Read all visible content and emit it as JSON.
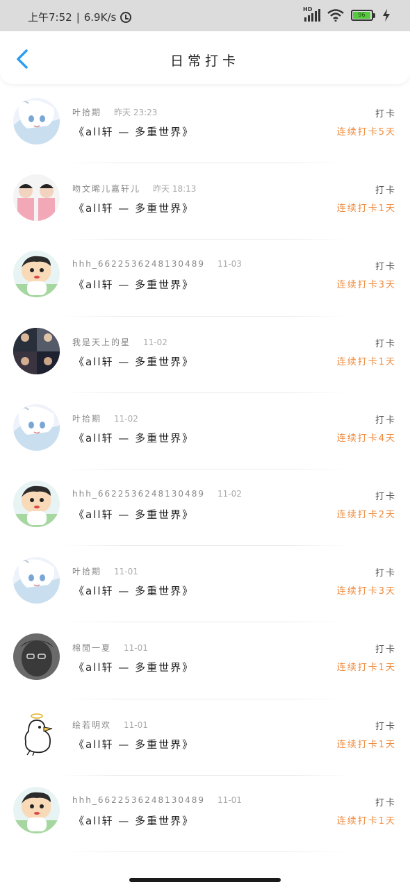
{
  "status_bar": {
    "time": "上午7:52",
    "speed": "6.9K/s",
    "network": "HD",
    "battery": "96"
  },
  "header": {
    "title": "日常打卡"
  },
  "items": [
    {
      "username": "叶拾期",
      "time": "昨天 23:23",
      "content": "《all轩 — 多重世界》",
      "tag": "打卡",
      "streak": "连续打卡5天",
      "avatar": "anime-avatar"
    },
    {
      "username": "吻文晞儿嘉轩儿",
      "time": "昨天 18:13",
      "content": "《all轩 — 多重世界》",
      "tag": "打卡",
      "streak": "连续打卡1天",
      "avatar": "photo-avatar"
    },
    {
      "username": "hhh_6622536248130489",
      "time": "11-03",
      "content": "《all轩 — 多重世界》",
      "tag": "打卡",
      "streak": "连续打卡3天",
      "avatar": "cartoon-avatar"
    },
    {
      "username": "我是天上的星",
      "time": "11-02",
      "content": "《all轩 — 多重世界》",
      "tag": "打卡",
      "streak": "连续打卡1天",
      "avatar": "group-photo-avatar"
    },
    {
      "username": "叶拾期",
      "time": "11-02",
      "content": "《all轩 — 多重世界》",
      "tag": "打卡",
      "streak": "连续打卡4天",
      "avatar": "anime-avatar"
    },
    {
      "username": "hhh_6622536248130489",
      "time": "11-02",
      "content": "《all轩 — 多重世界》",
      "tag": "打卡",
      "streak": "连续打卡2天",
      "avatar": "cartoon-avatar"
    },
    {
      "username": "叶拾期",
      "time": "11-01",
      "content": "《all轩 — 多重世界》",
      "tag": "打卡",
      "streak": "连续打卡3天",
      "avatar": "anime-avatar"
    },
    {
      "username": "棉閒一夏",
      "time": "11-01",
      "content": "《all轩 — 多重世界》",
      "tag": "打卡",
      "streak": "连续打卡1天",
      "avatar": "dark-photo-avatar"
    },
    {
      "username": "绘若明欢",
      "time": "11-01",
      "content": "《all轩 — 多重世界》",
      "tag": "打卡",
      "streak": "连续打卡1天",
      "avatar": "duck-avatar"
    },
    {
      "username": "hhh_6622536248130489",
      "time": "11-01",
      "content": "《all轩 — 多重世界》",
      "tag": "打卡",
      "streak": "连续打卡1天",
      "avatar": "cartoon-avatar"
    }
  ],
  "colors": {
    "accent": "#2a9df4",
    "streak": "#f08a3c",
    "status_bar_bg": "#dcdcdc"
  }
}
